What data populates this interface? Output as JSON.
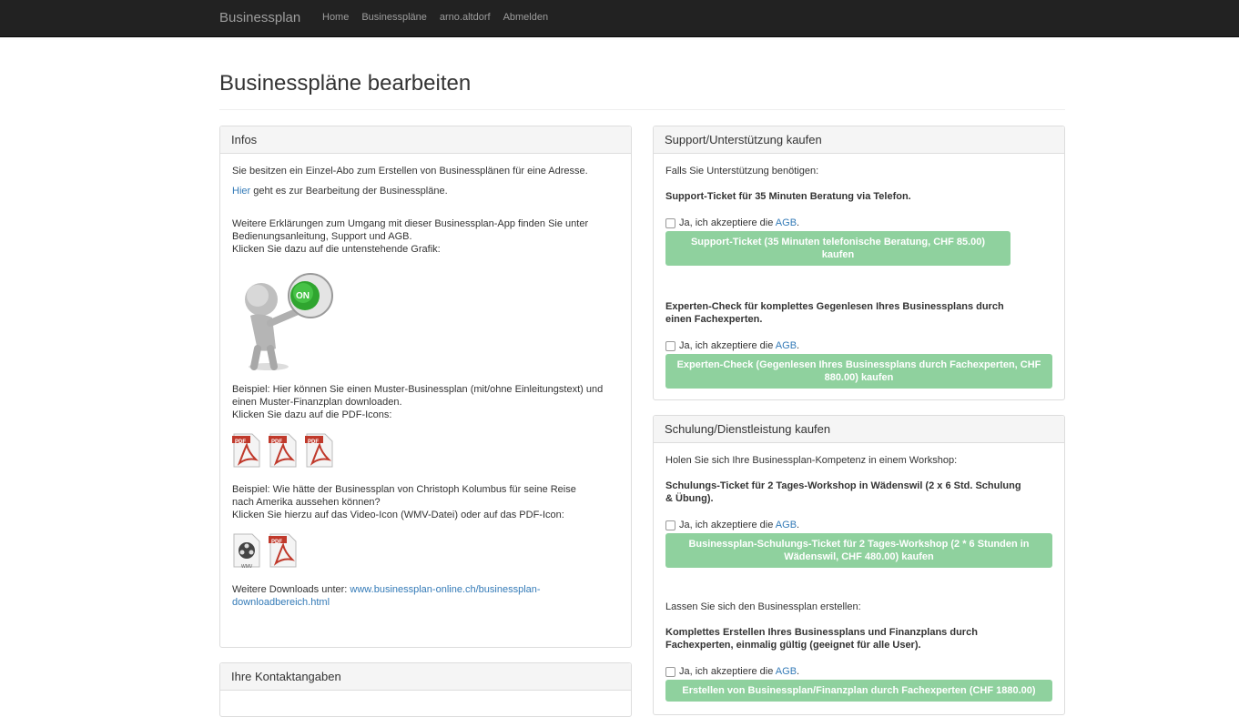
{
  "nav": {
    "brand": "Businessplan",
    "links": [
      "Home",
      "Businesspläne",
      "arno.altdorf",
      "Abmelden"
    ]
  },
  "page_title": "Businesspläne bearbeiten",
  "infos": {
    "heading": "Infos",
    "line1": "Sie besitzen ein Einzel-Abo zum Erstellen von Businessplänen für eine Adresse.",
    "hier_link": "Hier",
    "line2": " geht es zur Bearbeitung der Businesspläne.",
    "line3a": "Weitere Erklärungen zum Umgang mit dieser Businessplan-App finden Sie unter",
    "line3b": "Bedienungsanleitung, Support und AGB.",
    "line3c": "Klicken Sie dazu auf die untenstehende Grafik:",
    "on_label": "ON",
    "ex1a": "Beispiel: Hier können Sie einen Muster-Businessplan (mit/ohne Einleitungstext) und",
    "ex1b": "einen Muster-Finanzplan downloaden.",
    "ex1c": "Klicken Sie dazu auf die PDF-Icons:",
    "ex2a": "Beispiel: Wie hätte der Businessplan von Christoph Kolumbus für seine Reise",
    "ex2b": "nach Amerika aussehen können?",
    "ex2c": "Klicken Sie hierzu auf das Video-Icon (WMV-Datei) oder auf das PDF-Icon:",
    "downloads_label": "Weitere Downloads unter: ",
    "downloads_link1": "www.businessplan-online.ch/businessplan-",
    "downloads_link2": "downloadbereich.html",
    "pdf_label": "PDF",
    "wmv_label": "WMV"
  },
  "contact": {
    "heading": "Ihre Kontaktangaben"
  },
  "support": {
    "heading": "Support/Unterstützung kaufen",
    "intro": "Falls Sie Unterstützung benötigen:",
    "item1_title": "Support-Ticket für 35 Minuten Beratung via Telefon.",
    "item1_button": "Support-Ticket (35 Minuten telefonische Beratung, CHF 85.00) kaufen",
    "item2_title_a": "Experten-Check für komplettes Gegenlesen Ihres Businessplans durch",
    "item2_title_b": "einen Fachexperten.",
    "item2_button_a": "Experten-Check (Gegenlesen Ihres Businessplans durch Fachexperten, CHF",
    "item2_button_b": "880.00) kaufen"
  },
  "training": {
    "heading": "Schulung/Dienstleistung kaufen",
    "intro": "Holen Sie sich Ihre Businessplan-Kompetenz in einem Workshop:",
    "item1_title_a": "Schulungs-Ticket für 2 Tages-Workshop in Wädenswil (2 x 6 Std. Schulung",
    "item1_title_b": "& Übung).",
    "item1_button_a": "Businessplan-Schulungs-Ticket für 2 Tages-Workshop (2 * 6 Stunden in",
    "item1_button_b": "Wädenswil, CHF 480.00) kaufen",
    "intro2": "Lassen Sie sich den Businessplan erstellen:",
    "item2_title_a": "Komplettes Erstellen Ihres Businessplans und Finanzplans durch",
    "item2_title_b": "Fachexperten, einmalig gültig (geeignet für alle User).",
    "item2_button": "Erstellen von Businessplan/Finanzplan durch Fachexperten (CHF 1880.00)"
  },
  "agb": {
    "prefix": "Ja, ich akzeptiere die ",
    "link": "AGB",
    "suffix": "."
  },
  "colors": {
    "navbar": "#222222",
    "button_green": "#8fd19e",
    "link": "#337ab7"
  }
}
